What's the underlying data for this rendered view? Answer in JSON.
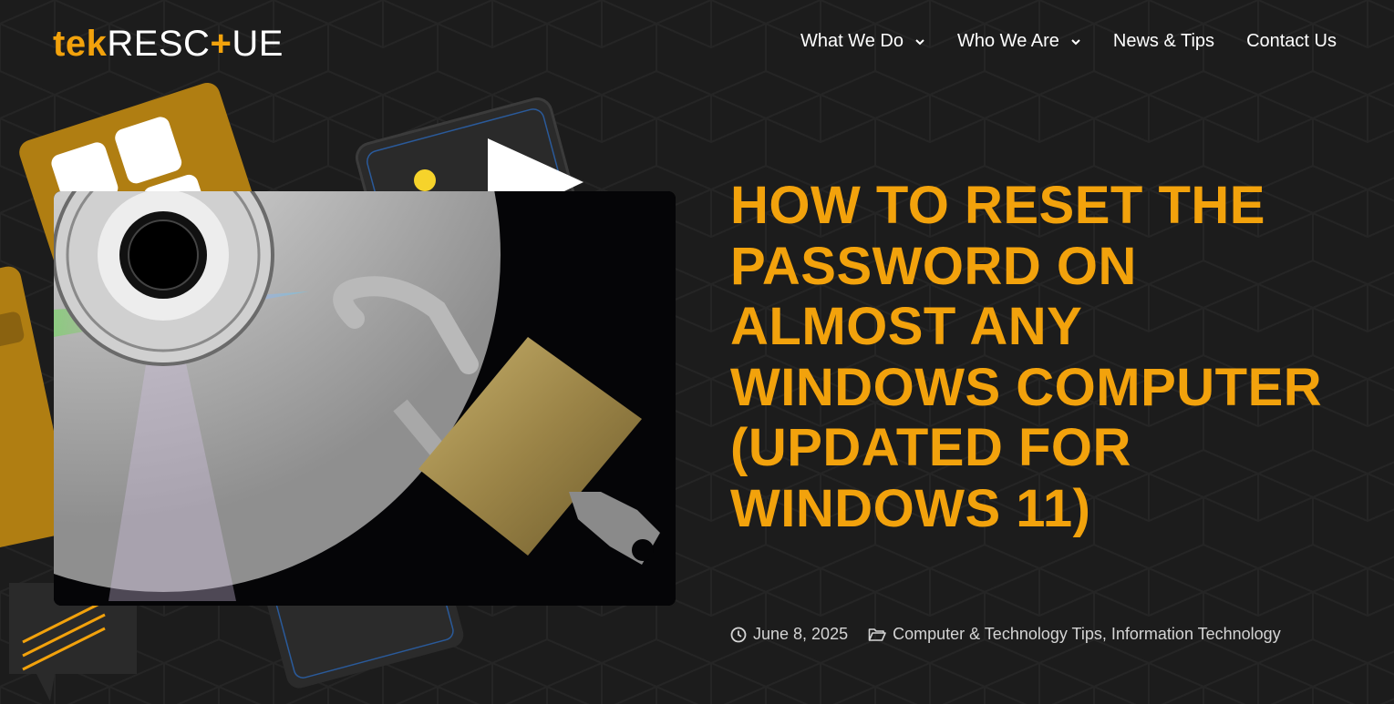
{
  "brand": {
    "logo_part1": "tek",
    "logo_part2": "RESC",
    "logo_part3": "+",
    "logo_part4": "UE",
    "accent_color": "#f2a20c",
    "background_color": "#1c1c1c"
  },
  "nav": {
    "items": [
      {
        "label": "What We Do",
        "has_dropdown": true
      },
      {
        "label": "Who We Are",
        "has_dropdown": true
      },
      {
        "label": "News & Tips",
        "has_dropdown": false
      },
      {
        "label": "Contact Us",
        "has_dropdown": false
      }
    ]
  },
  "hero": {
    "image_icon": "disc-padlock-key-image",
    "title": "HOW TO RESET THE PASSWORD ON ALMOST ANY WINDOWS COMPUTER (UPDATED FOR WINDOWS 11)"
  },
  "meta": {
    "date_icon": "clock-icon",
    "date": "June 8, 2025",
    "category_icon": "folder-icon",
    "category_1": "Computer & Technology Tips",
    "separator": ", ",
    "category_2": "Information Technology"
  }
}
